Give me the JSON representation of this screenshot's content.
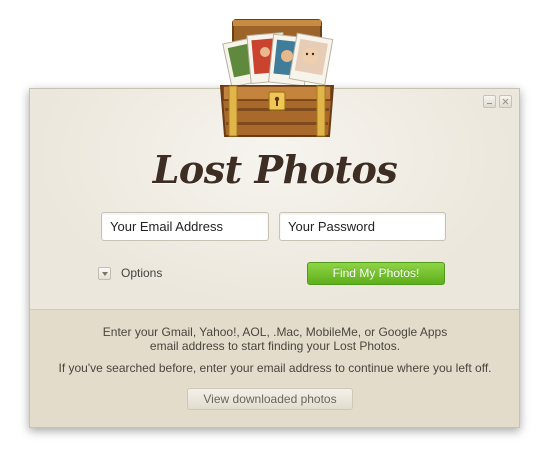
{
  "app": {
    "title": "Lost Photos"
  },
  "form": {
    "email_placeholder": "Your Email Address",
    "password_placeholder": "Your Password",
    "options_label": "Options",
    "find_button_label": "Find My Photos!"
  },
  "info": {
    "line1": "Enter your Gmail, Yahoo!, AOL, .Mac, MobileMe, or Google Apps",
    "line2": "email address to start finding your Lost Photos.",
    "line3": "If you've searched before, enter your email address to continue where you left off."
  },
  "footer": {
    "view_button_label": "View downloaded photos"
  },
  "colors": {
    "accent_green": "#6cbf2a",
    "title_brown": "#3e2d22",
    "panel_bg": "#ece7dc",
    "lower_panel_bg": "#e3dccb"
  },
  "icons": {
    "logo": "treasure-chest-icon",
    "options_toggle": "chevron-down-icon",
    "minimize": "minimize-icon",
    "close": "close-icon"
  }
}
